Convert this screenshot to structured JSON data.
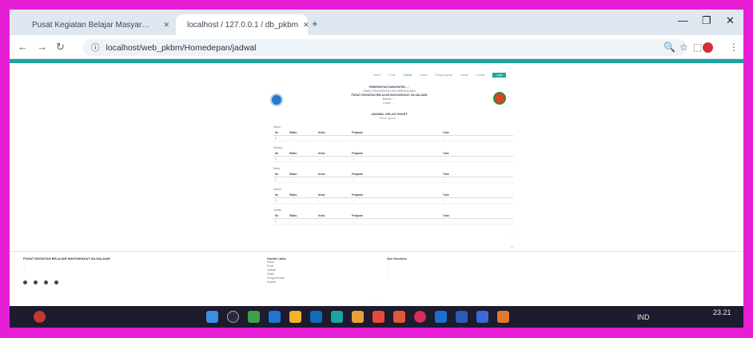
{
  "browser": {
    "tabs": [
      {
        "title": "Pusat Kegiatan Belajar Masyar…",
        "close": "✕"
      },
      {
        "title": "localhost / 127.0.0.1 / db_pkbm",
        "close": "✕"
      }
    ],
    "new_tab": "+",
    "window_controls": {
      "minimize": "—",
      "restore": "❐",
      "close": "✕"
    },
    "nav": {
      "back": "←",
      "forward": "→",
      "reload": "↻"
    },
    "address": "localhost/web_pkbm/Homedepan/jadwal",
    "info_icon": "ⓘ",
    "zoom_icon": "🔍",
    "star_icon": "☆",
    "ext_icon": "⬚",
    "menu_icon": "⋮"
  },
  "site": {
    "nav": [
      "Home",
      "Profil",
      "Jadwal",
      "Galeri",
      "Pengumuman",
      "Berita",
      "Kontak",
      "Login"
    ],
    "kop": [
      "PEMERINTAH KABUPATEN ….",
      "DINAS PENDIDIKAN DAN KEBUDAYAAN",
      "PUSAT KEGIATAN BELAJAR MASYARAKAT AS-SALAAM",
      "Alamat : …",
      "Email : …"
    ],
    "doc_title": "JADWAL KELAS PAKET",
    "doc_sub": "Tahun Ajaran …",
    "table_headers": [
      "No",
      "Waktu",
      "Kelas",
      "Pelajaran",
      "Tutor"
    ],
    "days": [
      {
        "name": "Senin",
        "rows": [
          {
            "no": "1",
            "waktu": "…",
            "kelas": "…",
            "pelajaran": "…",
            "tutor": "…"
          }
        ]
      },
      {
        "name": "Selasa",
        "rows": [
          {
            "no": "1",
            "waktu": "…",
            "kelas": "…",
            "pelajaran": "…",
            "tutor": "…"
          }
        ]
      },
      {
        "name": "Rabu",
        "rows": [
          {
            "no": "1",
            "waktu": "…",
            "kelas": "…",
            "pelajaran": "…",
            "tutor": "…"
          }
        ]
      },
      {
        "name": "Kamis",
        "rows": [
          {
            "no": "1",
            "waktu": "…",
            "kelas": "…",
            "pelajaran": "…",
            "tutor": "…"
          }
        ]
      },
      {
        "name": "Jumat",
        "rows": [
          {
            "no": "1",
            "waktu": "…",
            "kelas": "…",
            "pelajaran": "…",
            "tutor": "…"
          }
        ]
      }
    ],
    "signer": {
      "place_date": "…",
      "role": "…",
      "name": "…"
    },
    "footer": {
      "col1_title": "PUSAT KEGIATAN BELAJAR MASYARAKAT AS-SALAAM",
      "col1_lines": [
        "…",
        "…",
        "…",
        "…"
      ],
      "col2_title": "Useful Links",
      "col2_lines": [
        "Home",
        "Profil",
        "Jadwal",
        "Galeri",
        "Pengumuman",
        "Kontak"
      ],
      "col3_title": "Our Services",
      "col3_lines": [
        "…",
        "…",
        "…",
        "…",
        "…"
      ],
      "copyright": "…"
    }
  },
  "taskbar": {
    "lang": "IND",
    "time": "23.21"
  },
  "colors": {
    "accent": "#1aa5a0",
    "border": "#e61fd6"
  }
}
